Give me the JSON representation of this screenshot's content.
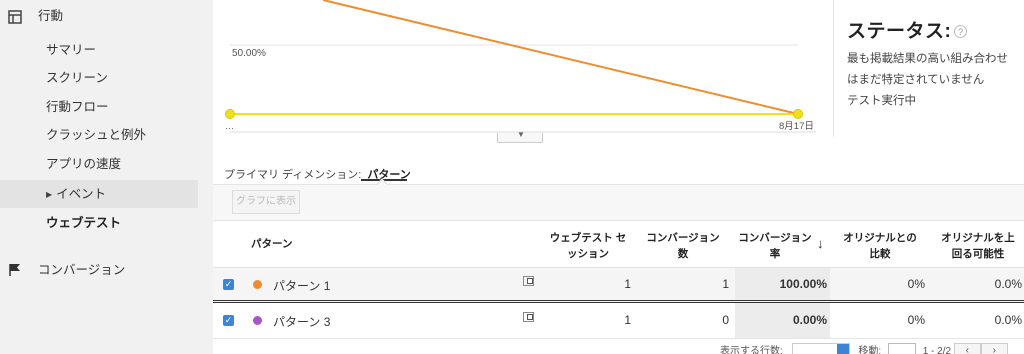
{
  "sidebar": {
    "behavior_label": "行動",
    "behavior_items": [
      {
        "label": "サマリー"
      },
      {
        "label": "スクリーン"
      },
      {
        "label": "行動フロー"
      },
      {
        "label": "クラッシュと例外"
      },
      {
        "label": "アプリの速度"
      },
      {
        "label": "イベント"
      },
      {
        "label": "ウェブテスト"
      }
    ],
    "conversions_label": "コンバージョン"
  },
  "chart_data": {
    "type": "line",
    "x_tick_labels": [
      "…",
      "8月17日"
    ],
    "y_tick_labels": [
      "50.00%"
    ],
    "series": [
      {
        "values": [
          null,
          0
        ],
        "color": "#f08c2b"
      },
      {
        "values": [
          null,
          0
        ],
        "color": "#f0e01c"
      }
    ]
  },
  "status": {
    "title": "ステータス:",
    "help": "?",
    "line1": "最も掲載結果の高い組み合わせ",
    "line2": "はまだ特定されていません",
    "line3": "テスト実行中"
  },
  "dimension": {
    "label": "プライマリ ディメンション:",
    "value": "パターン"
  },
  "toolbar": {
    "graph_button": "グラフに表示"
  },
  "table": {
    "headers": {
      "pattern": "パターン",
      "sessions_1": "ウェブテスト セ",
      "sessions_2": "ッション",
      "conversions_1": "コンバージョン",
      "conversions_2": "数",
      "rate_1": "コンバージョン",
      "rate_2": "率",
      "sort_arrow": "↓",
      "compare_1": "オリジナルとの",
      "compare_2": "比較",
      "beat_1": "オリジナルを上",
      "beat_2": "回る可能性"
    },
    "rows": [
      {
        "name": "パターン 1",
        "color": "#f08c2b",
        "sessions": "1",
        "conversions": "1",
        "rate": "100.00%",
        "compare": "0%",
        "beat": "0.0%"
      },
      {
        "name": "パターン 3",
        "color": "#a855c8",
        "sessions": "1",
        "conversions": "0",
        "rate": "0.00%",
        "compare": "0%",
        "beat": "0.0%"
      }
    ]
  },
  "pager": {
    "rows_label": "表示する行数:",
    "goto_label": "移動:",
    "page_value": "1",
    "range": "1 - 2/2",
    "prev": "‹",
    "next": "›"
  }
}
